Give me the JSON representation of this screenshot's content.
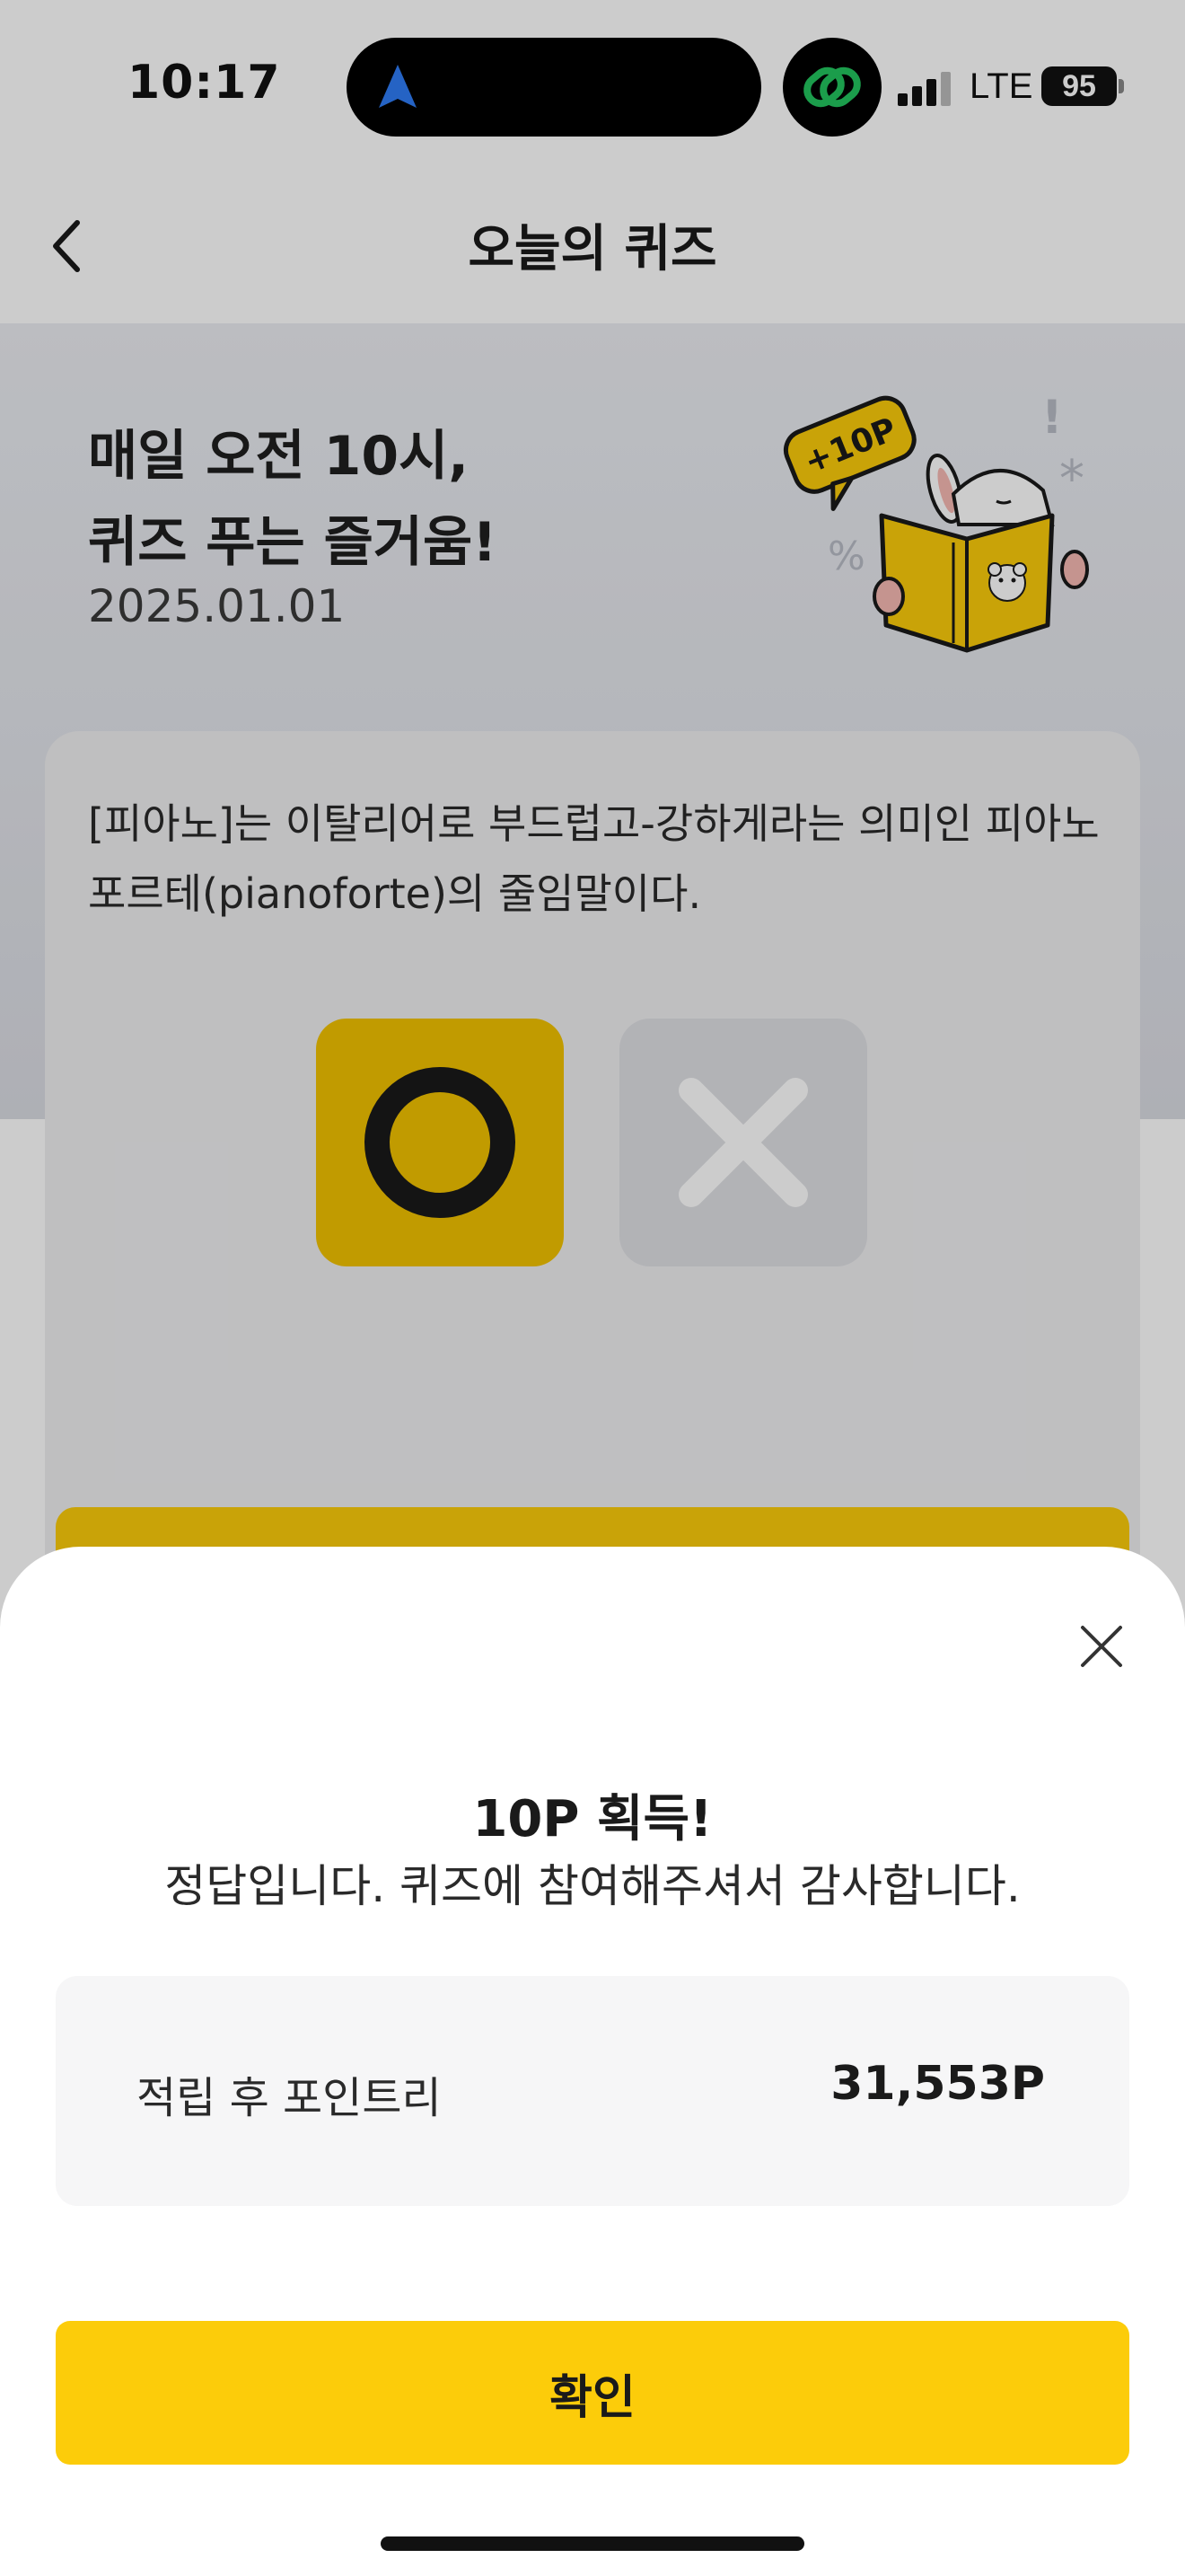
{
  "status_bar": {
    "time": "10:17",
    "network": "LTE",
    "battery": "95",
    "icons": [
      "navigation-arrow-icon",
      "linked-rings-app-icon",
      "signal-bars-icon",
      "battery-icon"
    ]
  },
  "header": {
    "title": "오늘의 퀴즈",
    "back_icon": "chevron-left-icon"
  },
  "hero": {
    "title_line1": "매일 오전 10시,",
    "title_line2": "퀴즈 푸는 즐거움!",
    "date": "2025.01.01",
    "badge": "+10P"
  },
  "quiz": {
    "question": "[피아노]는 이탈리어로 부드럽고-강하게라는 의미인 피아노포르테(pianoforte)의 줄임말이다.",
    "options": [
      "O",
      "X"
    ],
    "selected": "O"
  },
  "sheet": {
    "title": "10P 획득!",
    "message": "정답입니다. 퀴즈에 참여해주셔서 감사합니다.",
    "points_label": "적립 후 포인트리",
    "points_value": "31,553P",
    "confirm_label": "확인"
  },
  "colors": {
    "accent_yellow": "#fccc0a",
    "o_button": "#f2c200",
    "x_button": "#dfe0e4",
    "text_dark": "#1a1a1a",
    "o_green": "#22c55e",
    "nav_blue": "#2f7cf6"
  }
}
